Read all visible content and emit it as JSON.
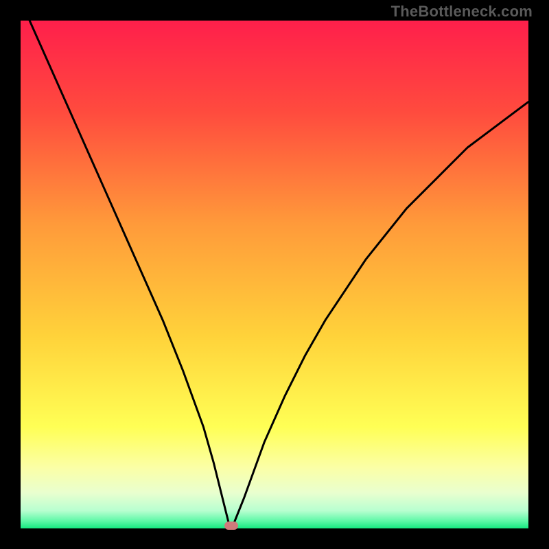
{
  "watermark": "TheBottleneck.com",
  "colors": {
    "frame": "#000000",
    "gradient_stops": [
      {
        "offset": 0.0,
        "color": "#ff1f4b"
      },
      {
        "offset": 0.18,
        "color": "#ff4b3e"
      },
      {
        "offset": 0.4,
        "color": "#ff9a3a"
      },
      {
        "offset": 0.62,
        "color": "#ffd23a"
      },
      {
        "offset": 0.8,
        "color": "#ffff55"
      },
      {
        "offset": 0.88,
        "color": "#fbffa6"
      },
      {
        "offset": 0.93,
        "color": "#e9ffcf"
      },
      {
        "offset": 0.965,
        "color": "#b8ffd0"
      },
      {
        "offset": 0.985,
        "color": "#60f8a8"
      },
      {
        "offset": 1.0,
        "color": "#15e880"
      }
    ],
    "curve": "#000000",
    "marker": "#cf7b7b"
  },
  "chart_data": {
    "type": "line",
    "title": "",
    "xlabel": "",
    "ylabel": "",
    "xlim": [
      0,
      100
    ],
    "ylim": [
      0,
      100
    ],
    "grid": false,
    "series": [
      {
        "name": "bottleneck-curve",
        "x": [
          0,
          4,
          8,
          12,
          16,
          20,
          24,
          28,
          32,
          36,
          38,
          40,
          41,
          42,
          44,
          48,
          52,
          56,
          60,
          64,
          68,
          72,
          76,
          80,
          84,
          88,
          92,
          96,
          100
        ],
        "values": [
          104,
          95,
          86,
          77,
          68,
          59,
          50,
          41,
          31,
          20,
          13,
          5,
          1,
          1,
          6,
          17,
          26,
          34,
          41,
          47,
          53,
          58,
          63,
          67,
          71,
          75,
          78,
          81,
          84
        ]
      }
    ],
    "annotations": [
      {
        "name": "min-marker",
        "x": 41.5,
        "y": 0.5
      }
    ]
  }
}
